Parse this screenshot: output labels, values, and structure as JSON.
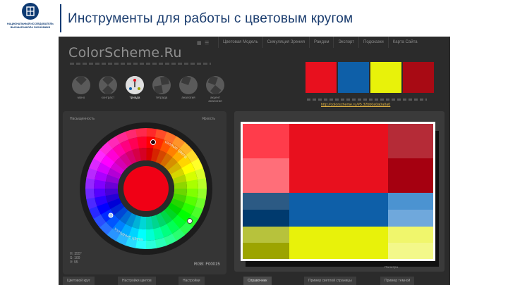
{
  "slide": {
    "title": "Инструменты для работы с цветовым кругом",
    "logo_text_line1": "НАЦИОНАЛЬНЫЙ ИССЛЕДОВАТЕЛЬСКИЙ УНИВЕРСИТЕТ",
    "logo_text_line2": "ВЫСШАЯ ШКОЛА ЭКОНОМИКИ"
  },
  "app": {
    "logo": "ColorScheme.Ru",
    "nav": [
      "Цветовая Модель",
      "Симуляция Зрения",
      "Рандом",
      "Экспорт",
      "Подсказки",
      "Карта Сайта"
    ],
    "schemes": [
      {
        "label": "моно",
        "active": false
      },
      {
        "label": "контраст",
        "active": false
      },
      {
        "label": "триада",
        "active": true
      },
      {
        "label": "тетрада",
        "active": false
      },
      {
        "label": "аналогия",
        "active": false
      },
      {
        "label": "акцент аналогия",
        "active": false
      }
    ],
    "preview_swatches": [
      "#e8101e",
      "#0e5fa8",
      "#e8f20a",
      "#a80a14"
    ],
    "preview_url": "http://colorscheme.ru/#5.32bb0a0a0a0a0",
    "wheel": {
      "label_top_left": "Насыщенность",
      "label_top_right": "Яркость",
      "arc_label_top": "теплые цвета",
      "arc_label_bottom": "холодные цвета",
      "center_color": "#f00015",
      "hsv_h": "H: 355°",
      "hsv_s": "S: 100",
      "hsv_v": "V: 95",
      "rgb": "RGB: F00015"
    },
    "palette": {
      "columns": [
        {
          "main": "#e8101e",
          "light": "#ff3c4b",
          "lighter": "#ff6e79",
          "dark": "#b52b37",
          "darker": "#a50010"
        },
        {
          "main": "#0e5fa8",
          "light": "#2c5a84",
          "lighter": "#2c5a84",
          "dark": "#4b93d1",
          "darker": "#003a6e"
        },
        {
          "main": "#e8f20a",
          "light": "#b7c23c",
          "lighter": "#b7c23c",
          "dark": "#f0f66c",
          "darker": "#9ca400"
        }
      ]
    },
    "footnote": "Палитра",
    "bottom_tabs": [
      {
        "label": "Цветовой круг",
        "active": false
      },
      {
        "label": "Настройки цветов",
        "active": false
      },
      {
        "label": "Настройки",
        "active": false
      },
      {
        "label": "Справочник",
        "active": true
      },
      {
        "label": "Пример светлой страницы",
        "active": false
      },
      {
        "label": "Пример темной",
        "active": false
      }
    ]
  }
}
